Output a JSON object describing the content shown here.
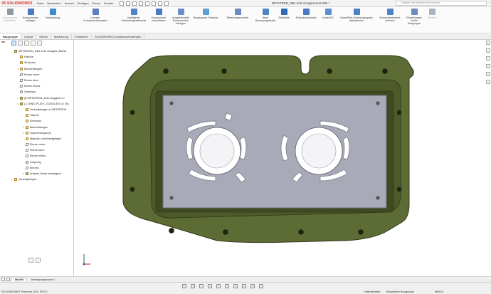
{
  "app": {
    "logo": "3S SOLIDWORKS",
    "menu": [
      "Datei",
      "Bearbeiten",
      "Ansicht",
      "Einfügen",
      "Extras",
      "Fenster"
    ],
    "document_title": "METATRON_GB1 Ecto Googles.SLDASM *",
    "search_placeholder": "Dateien und Modelle durchsuchen"
  },
  "ribbon": {
    "buttons": [
      {
        "label": "Komponente\nbearbeiten",
        "dim": true
      },
      {
        "label": "Komponenten\neinfügen",
        "dim": false
      },
      {
        "label": "Verknüpfung",
        "dim": false
      },
      {
        "label": "Linearer\nKomponentenmuster",
        "dim": false
      },
      {
        "label": "Intelligente\nVerbindungselemente",
        "dim": false
      },
      {
        "label": "Komponente\nverschieben",
        "dim": false
      },
      {
        "label": "Ausgeblendete\nKomponenten\nanzeigen",
        "dim": false
      },
      {
        "label": "Baugruppen-Features",
        "dim": false
      },
      {
        "label": "Referenzgeometrie",
        "dim": false
      },
      {
        "label": "Neue\nBewegungsstudie",
        "dim": false
      },
      {
        "label": "Stückliste",
        "dim": false
      },
      {
        "label": "Explosionsansicht",
        "dim": false
      },
      {
        "label": "Instant3D",
        "dim": false
      },
      {
        "label": "SpeedPak-Unterbaugruppen\naktualisieren",
        "dim": false
      },
      {
        "label": "Momentaufnahme\nnehmen",
        "dim": false
      },
      {
        "label": "Einstellungen\nGroße\nBaugruppe",
        "dim": false
      },
      {
        "label": "Weitere",
        "dim": true
      }
    ]
  },
  "tabs": [
    "Baugruppe",
    "Layout",
    "Skizze",
    "Markierung",
    "Evaluieren",
    "SOLIDWORKS Zusatzanwendungen"
  ],
  "tree": [
    {
      "label": "METATRON_GB1 Ecto Googles  (Stand-",
      "indent": 0,
      "icon": "part",
      "exp": ""
    },
    {
      "label": "Historie",
      "indent": 1,
      "icon": "folder",
      "exp": ""
    },
    {
      "label": "Sensoren",
      "indent": 1,
      "icon": "folder",
      "exp": ""
    },
    {
      "label": "Beschriftungen",
      "indent": 1,
      "icon": "folder",
      "exp": ">"
    },
    {
      "label": "Ebene vorne",
      "indent": 1,
      "icon": "plane",
      "exp": ""
    },
    {
      "label": "Ebene oben",
      "indent": 1,
      "icon": "plane",
      "exp": ""
    },
    {
      "label": "Ebene rechts",
      "indent": 1,
      "icon": "plane",
      "exp": ""
    },
    {
      "label": "Ursprung",
      "indent": 1,
      "icon": "round",
      "exp": ""
    },
    {
      "label": "(f) METATRON_Ecto-Goggles<1>",
      "indent": 1,
      "icon": "part",
      "exp": ">"
    },
    {
      "label": "(-) LENS_PLATE_GOGGLES<1> (St-",
      "indent": 1,
      "icon": "part",
      "exp": "v"
    },
    {
      "label": "Verknüpfungen in METATRON",
      "indent": 2,
      "icon": "folder",
      "exp": ""
    },
    {
      "label": "Historie",
      "indent": 2,
      "icon": "folder",
      "exp": ""
    },
    {
      "label": "Sensoren",
      "indent": 2,
      "icon": "folder",
      "exp": ""
    },
    {
      "label": "Beschriftungen",
      "indent": 2,
      "icon": "folder",
      "exp": ">"
    },
    {
      "label": "Volumenkörper(1)",
      "indent": 2,
      "icon": "folder",
      "exp": ">"
    },
    {
      "label": "Material <nicht festgelegt>",
      "indent": 2,
      "icon": "folder",
      "exp": ""
    },
    {
      "label": "Ebene vorne",
      "indent": 2,
      "icon": "plane",
      "exp": ""
    },
    {
      "label": "Ebene oben",
      "indent": 2,
      "icon": "plane",
      "exp": ""
    },
    {
      "label": "Ebene rechts",
      "indent": 2,
      "icon": "plane",
      "exp": ""
    },
    {
      "label": "Ursprung",
      "indent": 2,
      "icon": "round",
      "exp": ""
    },
    {
      "label": "Ebene1",
      "indent": 2,
      "icon": "plane",
      "exp": ""
    },
    {
      "label": "Aufsatz-Linear austragen1",
      "indent": 2,
      "icon": "part",
      "exp": ">"
    },
    {
      "label": "Verknüpfungen",
      "indent": 0,
      "icon": "folder",
      "exp": ">"
    }
  ],
  "bottom_tabs": [
    "Modell",
    "Bewegungsstudie 1"
  ],
  "status": {
    "left": "SOLIDWORKS Premium 2021 SP2.0",
    "underdefined": "Unterdefiniert",
    "editing": "Bearbeiten Baugruppe",
    "units": "MMGS"
  },
  "colors": {
    "frame": "#5d6b34",
    "frame_dark": "#3d4621",
    "plate": "#a9aab8",
    "plate_edge": "#6e6f7c"
  }
}
